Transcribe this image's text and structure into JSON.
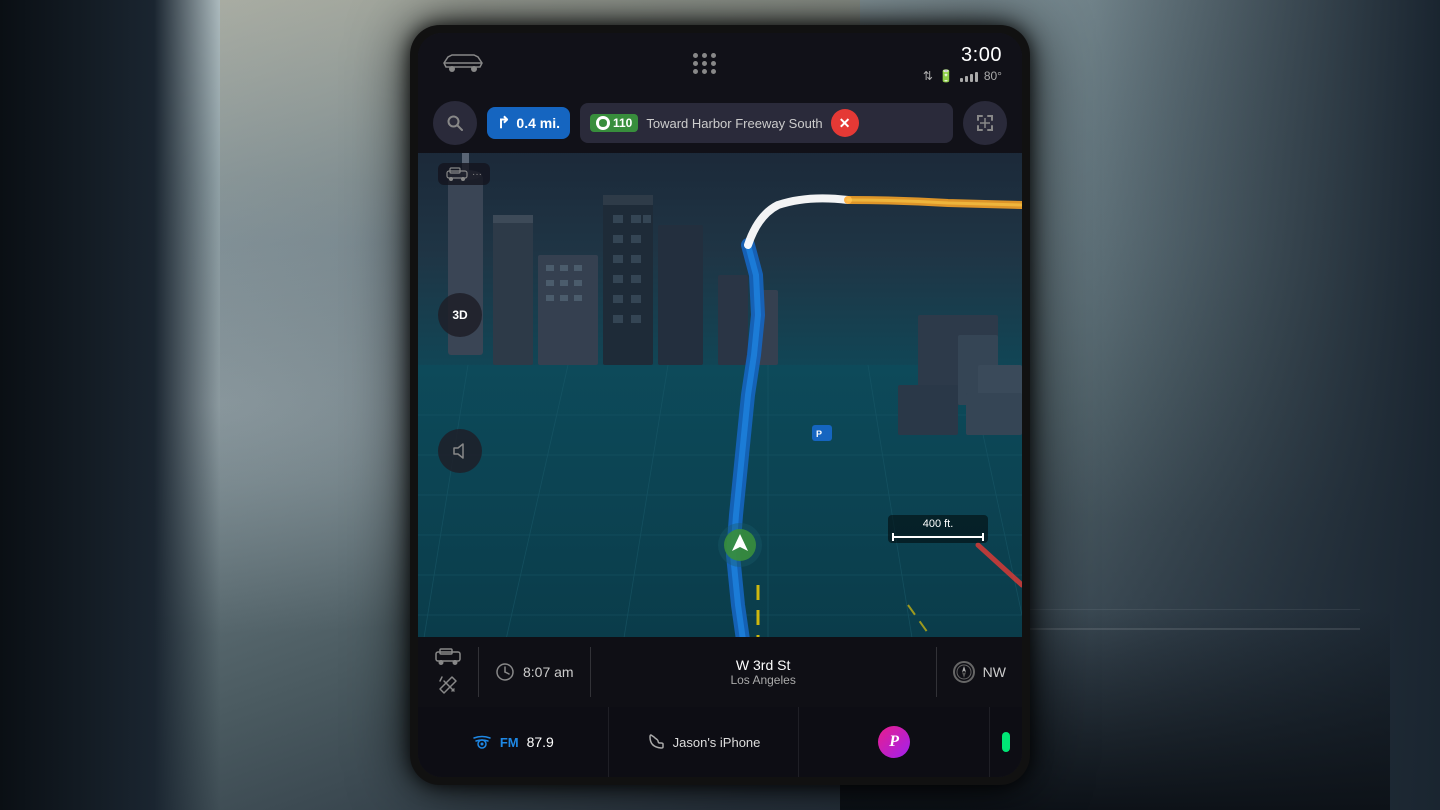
{
  "screen": {
    "status_bar": {
      "time": "3:00",
      "temperature": "80°",
      "apps_icon": "apps-grid"
    },
    "nav_bar": {
      "search_label": "Search",
      "distance": "0.4 mi.",
      "highway_number": "110",
      "toward_text": "Toward Harbor Freeway South",
      "close_label": "Close navigation",
      "fullscreen_label": "Fullscreen"
    },
    "map": {
      "view_mode": "3D",
      "scale_label": "400 ft.",
      "location_marker": "current location"
    },
    "bottom_info": {
      "time": "8:07 am",
      "street": "W 3rd St",
      "city": "Los Angeles",
      "direction": "NW"
    },
    "dock": {
      "fm_label": "FM",
      "fm_freq": "87.9",
      "phone_label": "Jason's iPhone",
      "pandora_label": "Pandora"
    }
  }
}
